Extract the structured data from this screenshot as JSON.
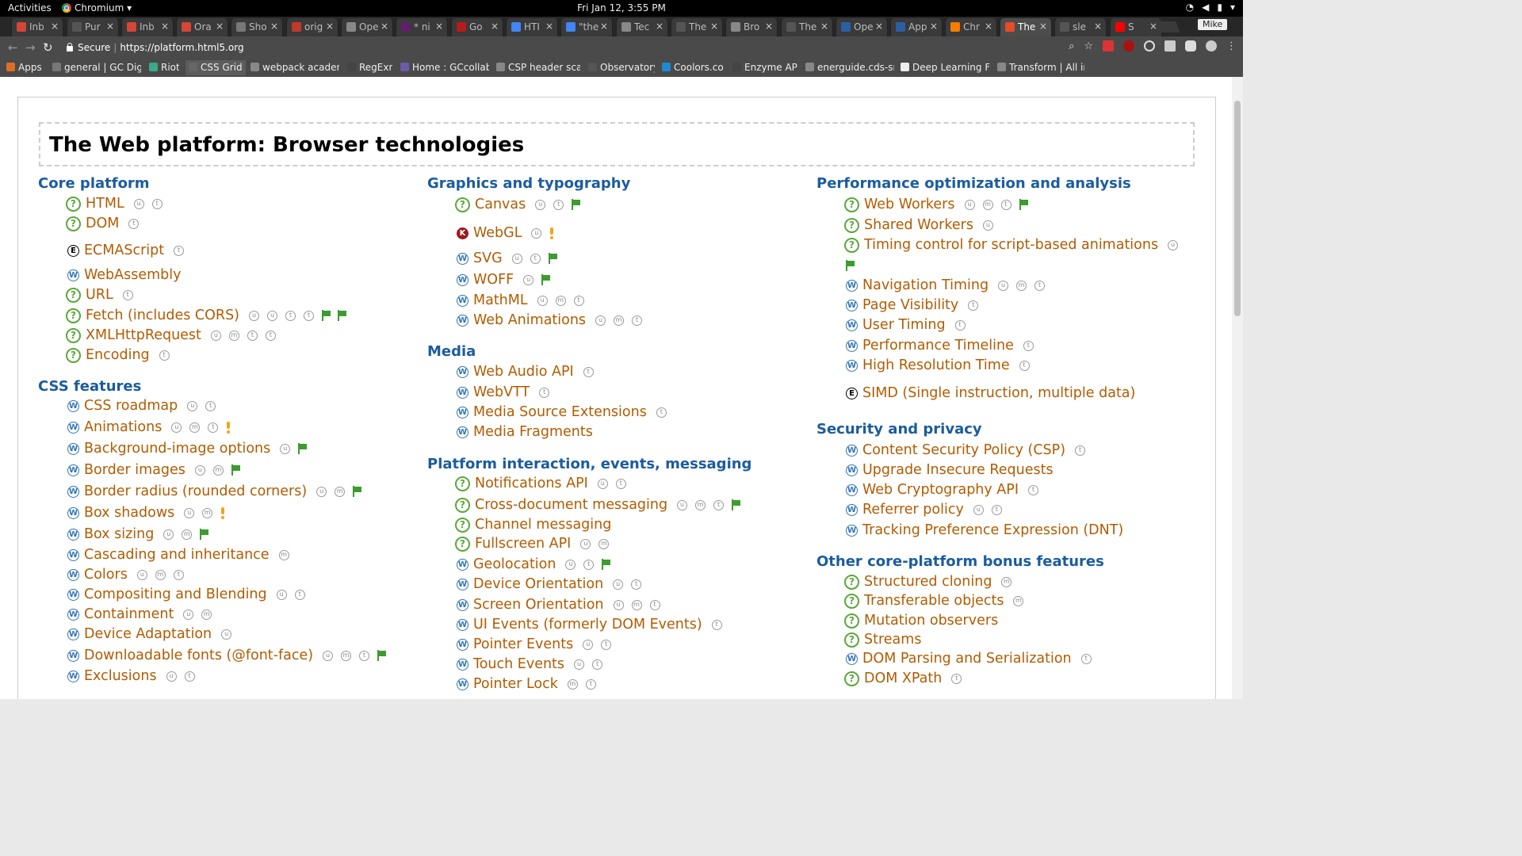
{
  "system_bar": {
    "activities": "Activities",
    "app_name": "Chromium ▾",
    "clock": "Fri Jan 12,  3:55 PM"
  },
  "tabs": [
    {
      "title": "Inb",
      "icon": "gmail-icon",
      "color": "#d44638"
    },
    {
      "title": "Pur",
      "icon": "github-icon",
      "color": "#555555"
    },
    {
      "title": "Inb",
      "icon": "gmail-icon",
      "color": "#d44638"
    },
    {
      "title": "Ora",
      "icon": "gmail-icon",
      "color": "#d44638"
    },
    {
      "title": "Sho",
      "icon": "link-icon",
      "color": "#777777"
    },
    {
      "title": "orig",
      "icon": "site-icon",
      "color": "#c0392b"
    },
    {
      "title": "Ope",
      "icon": "page-icon",
      "color": "#888888"
    },
    {
      "title": "* ni",
      "icon": "slack-icon",
      "color": "#611f69"
    },
    {
      "title": "Go",
      "icon": "w-icon",
      "color": "#b71c1c"
    },
    {
      "title": "HTI",
      "icon": "google-icon",
      "color": "#4285f4"
    },
    {
      "title": "\"the",
      "icon": "google-icon",
      "color": "#4285f4"
    },
    {
      "title": "Tec",
      "icon": "page-icon",
      "color": "#888888"
    },
    {
      "title": "The",
      "icon": "html5-icon",
      "color": "#555555"
    },
    {
      "title": "Bro",
      "icon": "page-icon",
      "color": "#888888"
    },
    {
      "title": "The",
      "icon": "html5-icon",
      "color": "#555555"
    },
    {
      "title": "Ope",
      "icon": "w3c-icon",
      "color": "#2a5fa5"
    },
    {
      "title": "App",
      "icon": "w3c-icon",
      "color": "#2a5fa5"
    },
    {
      "title": "Chr",
      "icon": "blogger-icon",
      "color": "#f57d00"
    },
    {
      "title": "The",
      "icon": "html5-icon",
      "color": "#e44d26",
      "active": true
    },
    {
      "title": "sle",
      "icon": "github-icon",
      "color": "#555555"
    },
    {
      "title": "S",
      "icon": "youtube-icon",
      "color": "#ff0000"
    }
  ],
  "profile": "Mike",
  "address": {
    "secure": "Secure",
    "url": "https://platform.html5.org"
  },
  "bookmarks": [
    {
      "label": "Apps",
      "icon": "apps-grid-icon"
    },
    {
      "label": "general | GC Dig",
      "icon": "slack-hash-icon"
    },
    {
      "label": "Riot",
      "icon": "riot-icon"
    },
    {
      "label": "CSS Grid",
      "icon": "grid-icon",
      "highlight": true
    },
    {
      "label": "webpack academ",
      "icon": "page-icon"
    },
    {
      "label": "RegExr",
      "icon": "regexr-icon"
    },
    {
      "label": "Home : GCcollab",
      "icon": "gccollab-icon"
    },
    {
      "label": "CSP header scan",
      "icon": "page-icon"
    },
    {
      "label": "Observatory",
      "icon": "observatory-icon"
    },
    {
      "label": "Coolors.co",
      "icon": "coolors-icon"
    },
    {
      "label": "Enzyme API",
      "icon": "enzyme-icon"
    },
    {
      "label": "energuide.cds-sn",
      "icon": "page-icon"
    },
    {
      "label": "Deep Learning Fo",
      "icon": "doc-icon"
    },
    {
      "label": "Transform | All in",
      "icon": "page-icon"
    }
  ],
  "page": {
    "title": "The Web platform: Browser technologies",
    "columns": [
      {
        "sections": [
          {
            "heading": "Core platform",
            "items": [
              {
                "icon": "q",
                "label": "HTML",
                "marks": [
                  "u",
                  "t"
                ]
              },
              {
                "icon": "q",
                "label": "DOM",
                "marks": [
                  "t"
                ]
              },
              {
                "icon": "e",
                "label": "ECMAScript",
                "marks": [
                  "t"
                ]
              },
              {
                "icon": "w",
                "label": "WebAssembly",
                "marks": []
              },
              {
                "icon": "q",
                "label": "URL",
                "marks": [
                  "t"
                ]
              },
              {
                "icon": "q",
                "label": "Fetch (includes CORS)",
                "marks": [
                  "u",
                  "u",
                  "t",
                  "t"
                ],
                "flags": 2
              },
              {
                "icon": "q",
                "label": "XMLHttpRequest",
                "marks": [
                  "u",
                  "m",
                  "t",
                  "t"
                ]
              },
              {
                "icon": "q",
                "label": "Encoding",
                "marks": [
                  "t"
                ]
              }
            ]
          },
          {
            "heading": "CSS features",
            "items": [
              {
                "icon": "w",
                "label": "CSS roadmap",
                "marks": [
                  "u",
                  "t"
                ]
              },
              {
                "icon": "w",
                "label": "Animations",
                "marks": [
                  "u",
                  "m",
                  "t"
                ],
                "excl": true
              },
              {
                "icon": "w",
                "label": "Background-image options",
                "marks": [
                  "u"
                ],
                "flags": 1
              },
              {
                "icon": "w",
                "label": "Border images",
                "marks": [
                  "u",
                  "m"
                ],
                "flags": 1
              },
              {
                "icon": "w",
                "label": "Border radius (rounded corners)",
                "marks": [
                  "u",
                  "m"
                ],
                "flags": 1
              },
              {
                "icon": "w",
                "label": "Box shadows",
                "marks": [
                  "u",
                  "m"
                ],
                "excl": true
              },
              {
                "icon": "w",
                "label": "Box sizing",
                "marks": [
                  "u",
                  "m"
                ],
                "flags": 1
              },
              {
                "icon": "w",
                "label": "Cascading and inheritance",
                "marks": [
                  "m"
                ]
              },
              {
                "icon": "w",
                "label": "Colors",
                "marks": [
                  "u",
                  "m",
                  "t"
                ]
              },
              {
                "icon": "w",
                "label": "Compositing and Blending",
                "marks": [
                  "u",
                  "t"
                ]
              },
              {
                "icon": "w",
                "label": "Containment",
                "marks": [
                  "u",
                  "m"
                ]
              },
              {
                "icon": "w",
                "label": "Device Adaptation",
                "marks": [
                  "u"
                ]
              },
              {
                "icon": "w",
                "label": "Downloadable fonts (@font-face)",
                "marks": [
                  "u",
                  "m",
                  "t"
                ],
                "flags": 1
              },
              {
                "icon": "w",
                "label": "Exclusions",
                "marks": [
                  "u",
                  "t"
                ]
              }
            ]
          }
        ]
      },
      {
        "sections": [
          {
            "heading": "Graphics and typography",
            "items": [
              {
                "icon": "q",
                "label": "Canvas",
                "marks": [
                  "u",
                  "t"
                ],
                "flags": 1
              },
              {
                "icon": "k",
                "label": "WebGL",
                "marks": [
                  "u"
                ],
                "excl": true
              },
              {
                "icon": "w",
                "label": "SVG",
                "marks": [
                  "u",
                  "t"
                ],
                "flags": 1
              },
              {
                "icon": "w",
                "label": "WOFF",
                "marks": [
                  "u"
                ],
                "flags": 1
              },
              {
                "icon": "w",
                "label": "MathML",
                "marks": [
                  "u",
                  "m",
                  "t"
                ]
              },
              {
                "icon": "w",
                "label": "Web Animations",
                "marks": [
                  "u",
                  "m",
                  "t"
                ]
              }
            ]
          },
          {
            "heading": "Media",
            "items": [
              {
                "icon": "w",
                "label": "Web Audio API",
                "marks": [
                  "t"
                ]
              },
              {
                "icon": "w",
                "label": "WebVTT",
                "marks": [
                  "t"
                ]
              },
              {
                "icon": "w",
                "label": "Media Source Extensions",
                "marks": [
                  "t"
                ]
              },
              {
                "icon": "w",
                "label": "Media Fragments",
                "marks": []
              }
            ]
          },
          {
            "heading": "Platform interaction, events, messaging",
            "items": [
              {
                "icon": "q",
                "label": "Notifications API",
                "marks": [
                  "u",
                  "t"
                ]
              },
              {
                "icon": "q",
                "label": "Cross-document messaging",
                "marks": [
                  "u",
                  "m",
                  "t"
                ],
                "flags": 1
              },
              {
                "icon": "q",
                "label": "Channel messaging",
                "marks": []
              },
              {
                "icon": "q",
                "label": "Fullscreen API",
                "marks": [
                  "u",
                  "m"
                ]
              },
              {
                "icon": "w",
                "label": "Geolocation",
                "marks": [
                  "u",
                  "t"
                ],
                "flags": 1
              },
              {
                "icon": "w",
                "label": "Device Orientation",
                "marks": [
                  "u",
                  "t"
                ]
              },
              {
                "icon": "w",
                "label": "Screen Orientation",
                "marks": [
                  "u",
                  "m",
                  "t"
                ]
              },
              {
                "icon": "w",
                "label": "UI Events (formerly DOM Events)",
                "marks": [
                  "t"
                ]
              },
              {
                "icon": "w",
                "label": "Pointer Events",
                "marks": [
                  "u",
                  "t"
                ]
              },
              {
                "icon": "w",
                "label": "Touch Events",
                "marks": [
                  "u",
                  "t"
                ]
              },
              {
                "icon": "w",
                "label": "Pointer Lock",
                "marks": [
                  "m",
                  "t"
                ]
              }
            ]
          }
        ]
      },
      {
        "sections": [
          {
            "heading": "Performance optimization and analysis",
            "items": [
              {
                "icon": "q",
                "label": "Web Workers",
                "marks": [
                  "u",
                  "m",
                  "t"
                ],
                "flags": 1
              },
              {
                "icon": "q",
                "label": "Shared Workers",
                "marks": [
                  "u"
                ]
              },
              {
                "icon": "q",
                "label": "Timing control for script-based animations",
                "marks": [
                  "u"
                ],
                "flag_below": true
              },
              {
                "icon": "w",
                "label": "Navigation Timing",
                "marks": [
                  "u",
                  "m",
                  "t"
                ]
              },
              {
                "icon": "w",
                "label": "Page Visibility",
                "marks": [
                  "t"
                ]
              },
              {
                "icon": "w",
                "label": "User Timing",
                "marks": [
                  "t"
                ]
              },
              {
                "icon": "w",
                "label": "Performance Timeline",
                "marks": [
                  "t"
                ]
              },
              {
                "icon": "w",
                "label": "High Resolution Time",
                "marks": [
                  "t"
                ]
              },
              {
                "icon": "e",
                "label": "SIMD (Single instruction, multiple data)",
                "marks": []
              }
            ]
          },
          {
            "heading": "Security and privacy",
            "items": [
              {
                "icon": "w",
                "label": "Content Security Policy (CSP)",
                "marks": [
                  "t"
                ]
              },
              {
                "icon": "w",
                "label": "Upgrade Insecure Requests",
                "marks": []
              },
              {
                "icon": "w",
                "label": "Web Cryptography API",
                "marks": [
                  "t"
                ]
              },
              {
                "icon": "w",
                "label": "Referrer policy",
                "marks": [
                  "u",
                  "t"
                ]
              },
              {
                "icon": "w",
                "label": "Tracking Preference Expression (DNT)",
                "marks": []
              }
            ]
          },
          {
            "heading": "Other core-platform bonus features",
            "items": [
              {
                "icon": "q",
                "label": "Structured cloning",
                "marks": [
                  "m"
                ]
              },
              {
                "icon": "q",
                "label": "Transferable objects",
                "marks": [
                  "m"
                ]
              },
              {
                "icon": "q",
                "label": "Mutation observers",
                "marks": []
              },
              {
                "icon": "q",
                "label": "Streams",
                "marks": []
              },
              {
                "icon": "w",
                "label": "DOM Parsing and Serialization",
                "marks": [
                  "t"
                ]
              },
              {
                "icon": "q",
                "label": "DOM XPath",
                "marks": [
                  "t"
                ]
              }
            ]
          }
        ]
      }
    ]
  }
}
